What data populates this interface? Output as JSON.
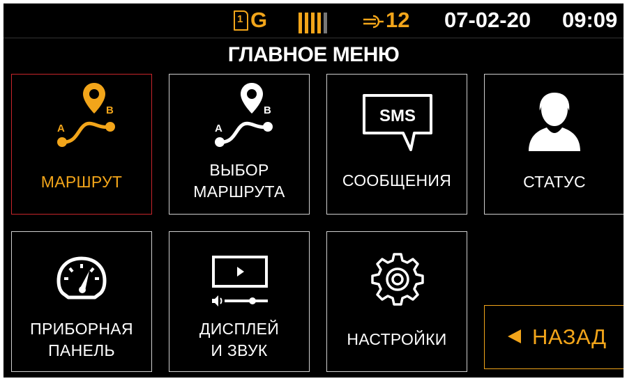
{
  "status_bar": {
    "sim_slot": "1",
    "sim_network": "G",
    "signal_bars_total": 5,
    "signal_bars_active": 4,
    "satellites": "12",
    "date": "07-02-20",
    "time": "09:09"
  },
  "header": {
    "title": "ГЛАВНОЕ МЕНЮ"
  },
  "route_points": {
    "a": "A",
    "b": "B"
  },
  "sms_icon_text": "SMS",
  "menu": [
    {
      "id": "route",
      "label_lines": [
        "МАРШРУТ"
      ],
      "icon": "route-pin-icon",
      "selected": true
    },
    {
      "id": "route-select",
      "label_lines": [
        "ВЫБОР",
        "МАРШРУТА"
      ],
      "icon": "route-select-icon",
      "selected": false
    },
    {
      "id": "messages",
      "label_lines": [
        "СООБЩЕНИЯ"
      ],
      "icon": "sms-bubble-icon",
      "selected": false
    },
    {
      "id": "status",
      "label_lines": [
        "СТАТУС"
      ],
      "icon": "user-icon",
      "selected": false
    },
    {
      "id": "dashboard",
      "label_lines": [
        "ПРИБОРНАЯ",
        "ПАНЕЛЬ"
      ],
      "icon": "speedometer-icon",
      "selected": false
    },
    {
      "id": "display-sound",
      "label_lines": [
        "ДИСПЛЕЙ",
        "И ЗВУК"
      ],
      "icon": "display-sound-icon",
      "selected": false
    },
    {
      "id": "settings",
      "label_lines": [
        "НАСТРОЙКИ"
      ],
      "icon": "gear-icon",
      "selected": false
    }
  ],
  "back_button": {
    "label": "НАЗАД",
    "icon": "left-triangle-icon"
  },
  "colors": {
    "accent": "#f2a51a",
    "selected_border": "#c8262b",
    "tile_border": "#cfcfcf",
    "background": "#000000",
    "text": "#ffffff"
  }
}
